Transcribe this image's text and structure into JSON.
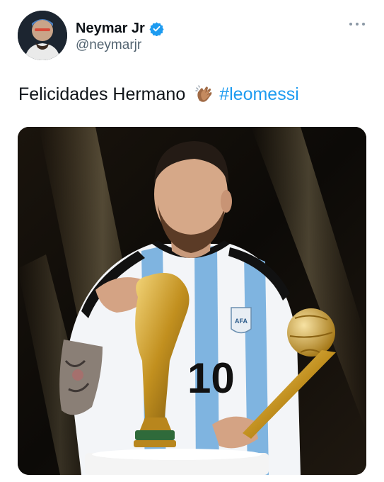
{
  "author": {
    "display_name": "Neymar Jr",
    "handle": "@neymarjr",
    "verified": true
  },
  "tweet": {
    "text": "Felicidades Hermano",
    "emoji": "clapping-hands",
    "hashtag": "#leomessi"
  },
  "media": {
    "jersey_number": "10",
    "badge_text": "AFA"
  },
  "colors": {
    "hashtag": "#1d9bf0",
    "verified": "#1d9bf0",
    "secondary_text": "#536471"
  },
  "icons": {
    "more": "more-options-icon",
    "verified": "verified-badge-icon",
    "clap": "clapping-hands-emoji"
  }
}
